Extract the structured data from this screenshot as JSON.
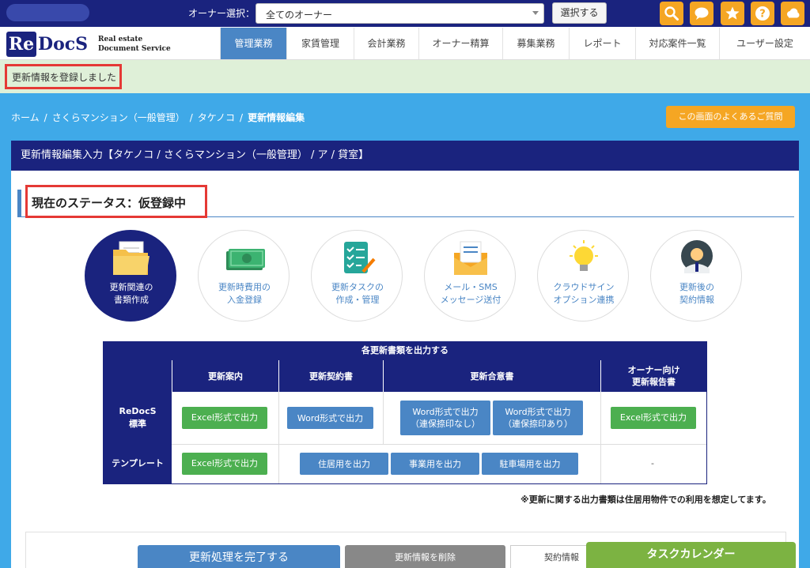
{
  "topbar": {
    "owner_label": "オーナー選択：",
    "owner_select_value": "全てのオーナー",
    "select_button": "選択する",
    "icons": [
      "search-icon",
      "chat-icon",
      "star-icon",
      "help-icon",
      "cloud-icon"
    ]
  },
  "logo": {
    "re": "Re",
    "docs": "DocS",
    "sub_line1": "Real estate",
    "sub_line2": "Document Service"
  },
  "nav": {
    "items": [
      {
        "label": "管理業務",
        "active": true
      },
      {
        "label": "家賃管理"
      },
      {
        "label": "会計業務"
      },
      {
        "label": "オーナー精算"
      },
      {
        "label": "募集業務"
      },
      {
        "label": "レポート"
      },
      {
        "label": "対応案件一覧"
      },
      {
        "label": "ユーザー設定"
      }
    ]
  },
  "flash": {
    "message": "更新情報を登録しました"
  },
  "breadcrumb": {
    "home": "ホーム",
    "property": "さくらマンション（一般管理）",
    "tenant": "タケノコ",
    "current": "更新情報編集"
  },
  "faq_button": "この画面のよくあるご質問",
  "panel": {
    "title": "更新情報編集入力【タケノコ / さくらマンション（一般管理） / ア / 貸室】",
    "status": "現在のステータス：仮登録中"
  },
  "steps": [
    {
      "label": "更新関連の\n書類作成",
      "icon": "folder-icon",
      "active": true
    },
    {
      "label": "更新時費用の\n入金登録",
      "icon": "money-icon"
    },
    {
      "label": "更新タスクの\n作成・管理",
      "icon": "checklist-icon"
    },
    {
      "label": "メール・SMS\nメッセージ送付",
      "icon": "mail-icon"
    },
    {
      "label": "クラウドサイン\nオプション連携",
      "icon": "lightbulb-icon"
    },
    {
      "label": "更新後の\n契約情報",
      "icon": "person-icon"
    }
  ],
  "output_table": {
    "caption": "各更新書類を出力する",
    "headers": {
      "notice": "更新案内",
      "contract": "更新契約書",
      "agreement": "更新合意書",
      "owner_report_1": "オーナー向け",
      "owner_report_2": "更新報告書"
    },
    "rows": {
      "standard_1": "ReDocS",
      "standard_2": "標準",
      "template": "テンプレート"
    },
    "buttons": {
      "excel_notice": "Excel形式で出力",
      "word_contract": "Word形式で出力",
      "word_agree_nostamp_1": "Word形式で出力",
      "word_agree_nostamp_2": "（連保捺印なし）",
      "word_agree_stamp_1": "Word形式で出力",
      "word_agree_stamp_2": "（連保捺印あり）",
      "excel_owner": "Excel形式で出力",
      "excel_template": "Excel形式で出力",
      "residential": "住居用を出力",
      "business": "事業用を出力",
      "parking": "駐車場用を出力"
    },
    "dash": "-",
    "note": "※更新に関する出力書類は住居用物件での利用を想定してます。"
  },
  "bottom": {
    "complete": "更新処理を完了する",
    "delete": "更新情報を削除",
    "contract": "契約情報",
    "task_calendar": "タスクカレンダー"
  },
  "colors": {
    "navy": "#1a237e",
    "blue": "#4a86c5",
    "sky": "#3fa9e8",
    "orange": "#f5a623",
    "green": "#4caf50",
    "red": "#e53935"
  }
}
